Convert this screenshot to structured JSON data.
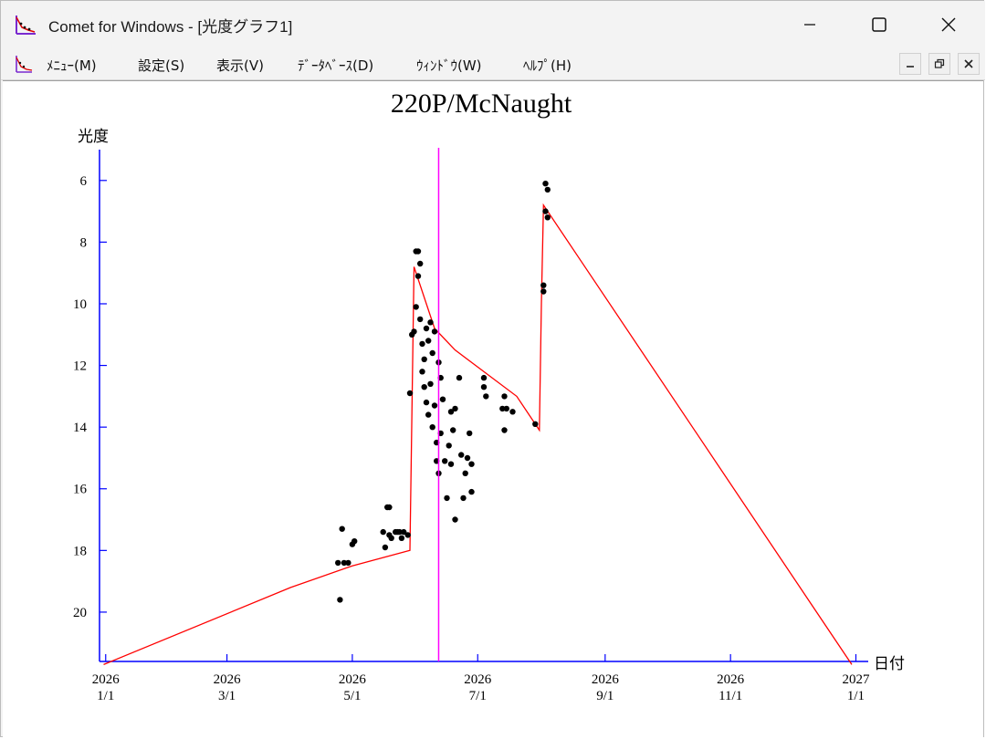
{
  "window": {
    "title": "Comet for Windows - [光度グラフ1]",
    "controls": [
      "minimize",
      "maximize",
      "close"
    ]
  },
  "menu": {
    "items": [
      "ﾒﾆｭｰ(M)",
      "設定(S)",
      "表示(V)",
      "ﾃﾞｰﾀﾍﾞｰｽ(D)",
      "ｳｨﾝﾄﾞｳ(W)",
      "ﾍﾙﾌﾟ(H)"
    ],
    "mdi_controls": [
      "minimize",
      "restore",
      "close"
    ]
  },
  "colors": {
    "axis": "#0000ff",
    "model_line": "#ff0000",
    "current_date_line": "#ff00ff",
    "points": "#000000"
  },
  "chart_data": {
    "type": "scatter",
    "title": "220P/McNaught",
    "ylabel": "光度",
    "xlabel": "日付",
    "y_inverted": true,
    "ylim": [
      21.6,
      5
    ],
    "xlim": [
      "2025-12-29",
      "2027-01-07"
    ],
    "y_ticks": [
      6,
      8,
      10,
      12,
      14,
      16,
      18,
      20
    ],
    "x_ticks": [
      {
        "date": "2026-01-01",
        "line1": "2026",
        "line2": "1/1"
      },
      {
        "date": "2026-03-01",
        "line1": "2026",
        "line2": "3/1"
      },
      {
        "date": "2026-05-01",
        "line1": "2026",
        "line2": "5/1"
      },
      {
        "date": "2026-07-01",
        "line1": "2026",
        "line2": "7/1"
      },
      {
        "date": "2026-09-01",
        "line1": "2026",
        "line2": "9/1"
      },
      {
        "date": "2026-11-01",
        "line1": "2026",
        "line2": "11/1"
      },
      {
        "date": "2027-01-01",
        "line1": "2027",
        "line2": "1/1"
      }
    ],
    "current_date": "2026-06-12",
    "model_line": [
      [
        "2025-12-31",
        21.7
      ],
      [
        "2026-04-01",
        19.2
      ],
      [
        "2026-05-01",
        18.5
      ],
      [
        "2026-05-29",
        18.0
      ],
      [
        "2026-05-30",
        13.5
      ],
      [
        "2026-05-31",
        8.8
      ],
      [
        "2026-06-10",
        10.8
      ],
      [
        "2026-06-20",
        11.5
      ],
      [
        "2026-07-20",
        13.0
      ],
      [
        "2026-07-31",
        14.1
      ],
      [
        "2026-08-01",
        10.0
      ],
      [
        "2026-08-02",
        6.8
      ],
      [
        "2026-12-30",
        21.7
      ]
    ],
    "observations": [
      [
        "2026-04-24",
        18.4
      ],
      [
        "2026-04-26",
        17.3
      ],
      [
        "2026-04-27",
        18.4
      ],
      [
        "2026-04-25",
        19.6
      ],
      [
        "2026-04-29",
        18.4
      ],
      [
        "2026-05-01",
        17.8
      ],
      [
        "2026-05-02",
        17.7
      ],
      [
        "2026-05-16",
        17.4
      ],
      [
        "2026-05-17",
        17.9
      ],
      [
        "2026-05-18",
        16.6
      ],
      [
        "2026-05-19",
        16.6
      ],
      [
        "2026-05-19",
        17.5
      ],
      [
        "2026-05-20",
        17.6
      ],
      [
        "2026-05-22",
        17.4
      ],
      [
        "2026-05-23",
        17.4
      ],
      [
        "2026-05-24",
        17.4
      ],
      [
        "2026-05-25",
        17.6
      ],
      [
        "2026-05-26",
        17.4
      ],
      [
        "2026-05-28",
        17.5
      ],
      [
        "2026-05-29",
        12.9
      ],
      [
        "2026-05-30",
        11.0
      ],
      [
        "2026-05-31",
        10.9
      ],
      [
        "2026-06-01",
        8.3
      ],
      [
        "2026-06-02",
        8.3
      ],
      [
        "2026-06-01",
        10.1
      ],
      [
        "2026-06-02",
        9.1
      ],
      [
        "2026-06-03",
        8.7
      ],
      [
        "2026-06-03",
        10.5
      ],
      [
        "2026-06-04",
        11.3
      ],
      [
        "2026-06-04",
        12.2
      ],
      [
        "2026-06-05",
        11.8
      ],
      [
        "2026-06-05",
        12.7
      ],
      [
        "2026-06-06",
        13.2
      ],
      [
        "2026-06-06",
        10.8
      ],
      [
        "2026-06-07",
        11.2
      ],
      [
        "2026-06-07",
        13.6
      ],
      [
        "2026-06-08",
        10.6
      ],
      [
        "2026-06-08",
        12.6
      ],
      [
        "2026-06-09",
        11.6
      ],
      [
        "2026-06-09",
        14.0
      ],
      [
        "2026-06-10",
        10.9
      ],
      [
        "2026-06-10",
        13.3
      ],
      [
        "2026-06-11",
        14.5
      ],
      [
        "2026-06-11",
        15.1
      ],
      [
        "2026-06-12",
        15.5
      ],
      [
        "2026-06-12",
        11.9
      ],
      [
        "2026-06-13",
        12.4
      ],
      [
        "2026-06-13",
        14.2
      ],
      [
        "2026-06-14",
        13.1
      ],
      [
        "2026-06-15",
        15.1
      ],
      [
        "2026-06-16",
        16.3
      ],
      [
        "2026-06-17",
        14.6
      ],
      [
        "2026-06-18",
        13.5
      ],
      [
        "2026-06-18",
        15.2
      ],
      [
        "2026-06-19",
        14.1
      ],
      [
        "2026-06-20",
        17.0
      ],
      [
        "2026-06-20",
        13.4
      ],
      [
        "2026-06-22",
        12.4
      ],
      [
        "2026-06-23",
        14.9
      ],
      [
        "2026-06-24",
        16.3
      ],
      [
        "2026-06-25",
        15.5
      ],
      [
        "2026-06-26",
        15.0
      ],
      [
        "2026-06-27",
        14.2
      ],
      [
        "2026-06-28",
        16.1
      ],
      [
        "2026-06-28",
        15.2
      ],
      [
        "2026-07-04",
        12.7
      ],
      [
        "2026-07-04",
        12.4
      ],
      [
        "2026-07-05",
        13.0
      ],
      [
        "2026-07-13",
        13.4
      ],
      [
        "2026-07-14",
        13.0
      ],
      [
        "2026-07-14",
        14.1
      ],
      [
        "2026-07-15",
        13.4
      ],
      [
        "2026-07-18",
        13.5
      ],
      [
        "2026-07-29",
        13.9
      ],
      [
        "2026-08-02",
        9.4
      ],
      [
        "2026-08-02",
        9.6
      ],
      [
        "2026-08-03",
        7.0
      ],
      [
        "2026-08-03",
        6.1
      ],
      [
        "2026-08-04",
        6.3
      ],
      [
        "2026-08-04",
        7.2
      ]
    ]
  }
}
